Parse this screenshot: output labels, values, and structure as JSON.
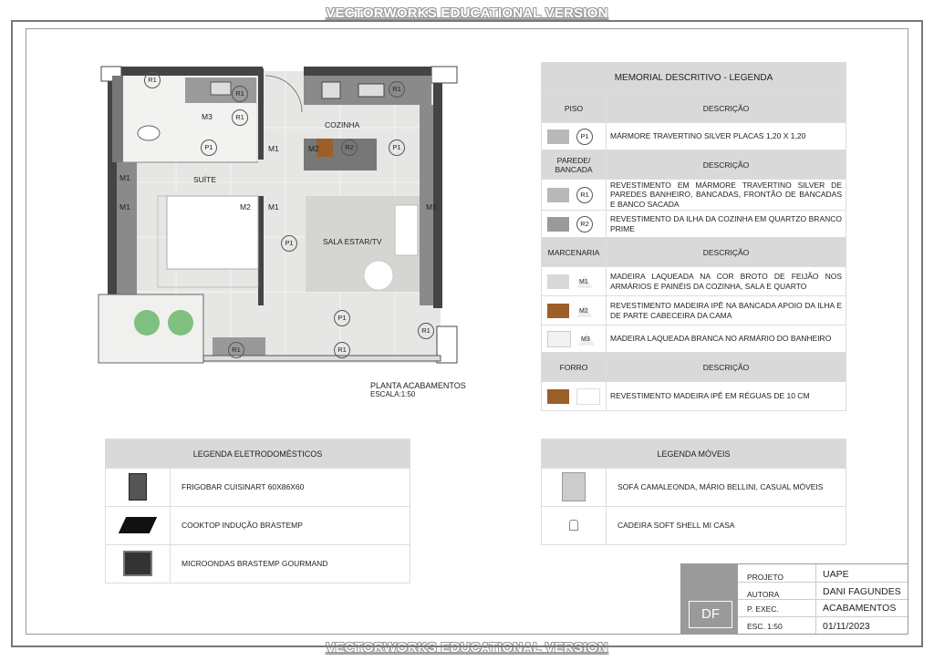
{
  "watermark_top": "VECTORWORKS EDUCATIONAL VERSION",
  "watermark_bottom": "VECTORWORKS EDUCATIONAL VERSION",
  "plan": {
    "caption": "PLANTA ACABAMENTOS",
    "scale": "ESCALA:1:50",
    "rooms": {
      "suite": "SUÍTE",
      "cozinha": "COZINHA",
      "sala": "SALA ESTAR/TV"
    },
    "tags": {
      "p1": "P1",
      "r1": "R1",
      "r2": "R2",
      "m1": "M1",
      "m2": "M2",
      "m3": "M3"
    }
  },
  "memorial": {
    "title": "MEMORIAL DESCRITIVO - LEGENDA",
    "desc_header": "DESCRIÇÃO",
    "piso": {
      "label": "PISO",
      "code": "P1",
      "text": "MÁRMORE TRAVERTINO SILVER PLACAS 1,20 X 1,20"
    },
    "parede": {
      "label": "PAREDE/ BANCADA",
      "items": [
        {
          "code": "R1",
          "text": "REVESTIMENTO EM MÁRMORE TRAVERTINO SILVER DE PAREDES BANHEIRO, BANCADAS, FRONTÃO DE BANCADAS E BANCO SACADA"
        },
        {
          "code": "R2",
          "text": "REVESTIMENTO DA ILHA DA COZINHA EM QUARTZO BRANCO PRIME"
        }
      ]
    },
    "marcenaria": {
      "label": "MARCENARIA",
      "items": [
        {
          "code": "M1",
          "text": "MADEIRA LAQUEADA NA COR BROTO DE FEIJÃO NOS ARMÁRIOS E PAINÉIS DA COZINHA, SALA E QUARTO"
        },
        {
          "code": "M2",
          "text": "REVESTIMENTO MADEIRA IPÊ NA BANCADA APOIO DA ILHA E DE PARTE CABECEIRA DA CAMA"
        },
        {
          "code": "M3",
          "text": "MADEIRA LAQUEADA BRANCA NO ARMÁRIO DO BANHEIRO"
        }
      ]
    },
    "forro": {
      "label": "FORRO",
      "text": "REVESTIMENTO MADEIRA IPÊ EM RÉGUAS DE 10 CM"
    }
  },
  "eletro": {
    "title": "LEGENDA ELETRODOMÉSTICOS",
    "items": [
      "FRIGOBAR CUISINART 60X86X60",
      "COOKTOP INDUÇÃO BRASTEMP",
      "MICROONDAS BRASTEMP GOURMAND"
    ]
  },
  "moveis": {
    "title": "LEGENDA MÓVEIS",
    "items": [
      "SOFÁ CAMALEONDA, MÁRIO BELLINI, CASUAL MÓVEIS",
      "CADEIRA SOFT SHELL MI CASA"
    ]
  },
  "title_block": {
    "logo": "DF",
    "projeto_label": "PROJETO",
    "projeto": "UAPE",
    "autora_label": "AUTORA",
    "autora": "DANI FAGUNDES",
    "pexec_label": "P. EXEC.",
    "pexec": "ACABAMENTOS",
    "esc_label": "ESC. 1:50",
    "date": "01/11/2023"
  },
  "colors": {
    "wall": "#444444",
    "floor": "#e6e6e4",
    "cabinet": "#8a8a8a",
    "wood": "#9b5f2a",
    "marble": "#b8b8b8"
  }
}
